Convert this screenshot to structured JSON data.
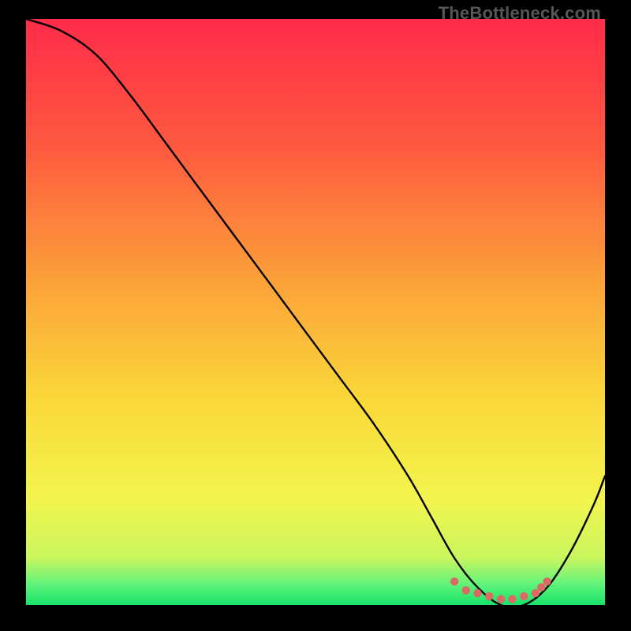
{
  "watermark": "TheBottleneck.com",
  "chart_data": {
    "type": "line",
    "title": "",
    "xlabel": "",
    "ylabel": "",
    "xlim": [
      0,
      100
    ],
    "ylim": [
      0,
      100
    ],
    "series": [
      {
        "name": "bottleneck-curve",
        "x": [
          0,
          6,
          12,
          18,
          24,
          30,
          36,
          42,
          48,
          54,
          60,
          66,
          70,
          74,
          78,
          82,
          86,
          90,
          94,
          98,
          100
        ],
        "values": [
          100,
          98,
          94,
          87,
          79,
          71,
          63,
          55,
          47,
          39,
          31,
          22,
          15,
          8,
          3,
          0,
          0,
          3,
          9,
          17,
          22
        ]
      }
    ],
    "markers": {
      "name": "optimal-range-dots",
      "color": "#da6a63",
      "x": [
        74,
        76,
        78,
        80,
        82,
        84,
        86,
        88,
        89,
        90
      ],
      "values": [
        4,
        2.5,
        2,
        1.5,
        1,
        1,
        1.5,
        2,
        3,
        4
      ]
    },
    "gradient_stops": [
      {
        "offset": 0.0,
        "color": "#ff2b4a"
      },
      {
        "offset": 0.22,
        "color": "#fe5a3f"
      },
      {
        "offset": 0.45,
        "color": "#fca239"
      },
      {
        "offset": 0.65,
        "color": "#fad839"
      },
      {
        "offset": 0.82,
        "color": "#f3f54e"
      },
      {
        "offset": 0.92,
        "color": "#c9f65f"
      },
      {
        "offset": 0.965,
        "color": "#5ff37a"
      },
      {
        "offset": 1.0,
        "color": "#17e36a"
      }
    ]
  }
}
